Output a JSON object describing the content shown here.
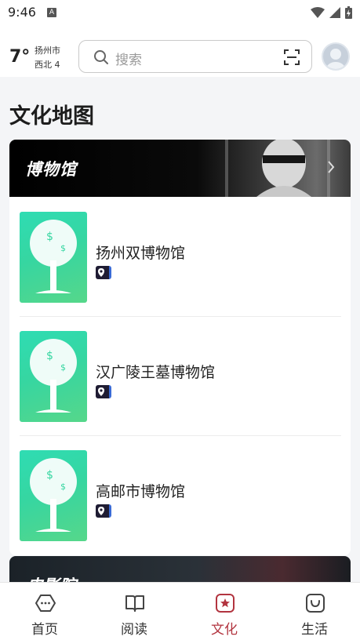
{
  "status_bar": {
    "time": "9:46",
    "notification_icon": "A"
  },
  "header": {
    "temperature": "7°",
    "city": "扬州市",
    "wind": "西北 4",
    "search_placeholder": "搜索"
  },
  "page_title": "文化地图",
  "museum_card": {
    "banner_title": "博物馆",
    "items": [
      {
        "name": "扬州双博物馆"
      },
      {
        "name": "汉广陵王墓博物馆"
      },
      {
        "name": "高邮市博物馆"
      }
    ]
  },
  "cinema_card": {
    "banner_title": "电影院"
  },
  "bottom_nav": {
    "items": [
      {
        "label": "首页",
        "icon": "home-icon"
      },
      {
        "label": "阅读",
        "icon": "book-icon"
      },
      {
        "label": "文化",
        "icon": "star-icon"
      },
      {
        "label": "生活",
        "icon": "bag-icon"
      }
    ],
    "active_color": "#b2343f"
  }
}
